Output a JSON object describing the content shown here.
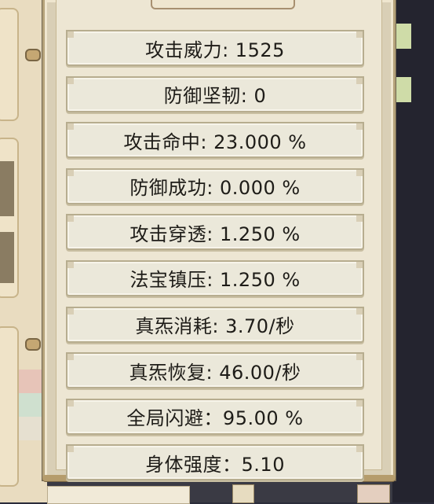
{
  "stats": [
    {
      "text": "攻击威力: 1525"
    },
    {
      "text": "防御坚韧: 0"
    },
    {
      "text": "攻击命中: 23.000 %"
    },
    {
      "text": "防御成功: 0.000 %"
    },
    {
      "text": "攻击穿透: 1.250 %"
    },
    {
      "text": "法宝镇压: 1.250 %"
    },
    {
      "text": "真炁消耗: 3.70/秒"
    },
    {
      "text": "真炁恢复: 46.00/秒"
    },
    {
      "text": "全局闪避：95.00 %"
    },
    {
      "text": "身体强度：5.10"
    }
  ],
  "colors": {
    "panel_bg": "#ede6d3",
    "row_bg": "#ebe8da",
    "frame": "#b5a27a",
    "text": "#1e1c18"
  }
}
